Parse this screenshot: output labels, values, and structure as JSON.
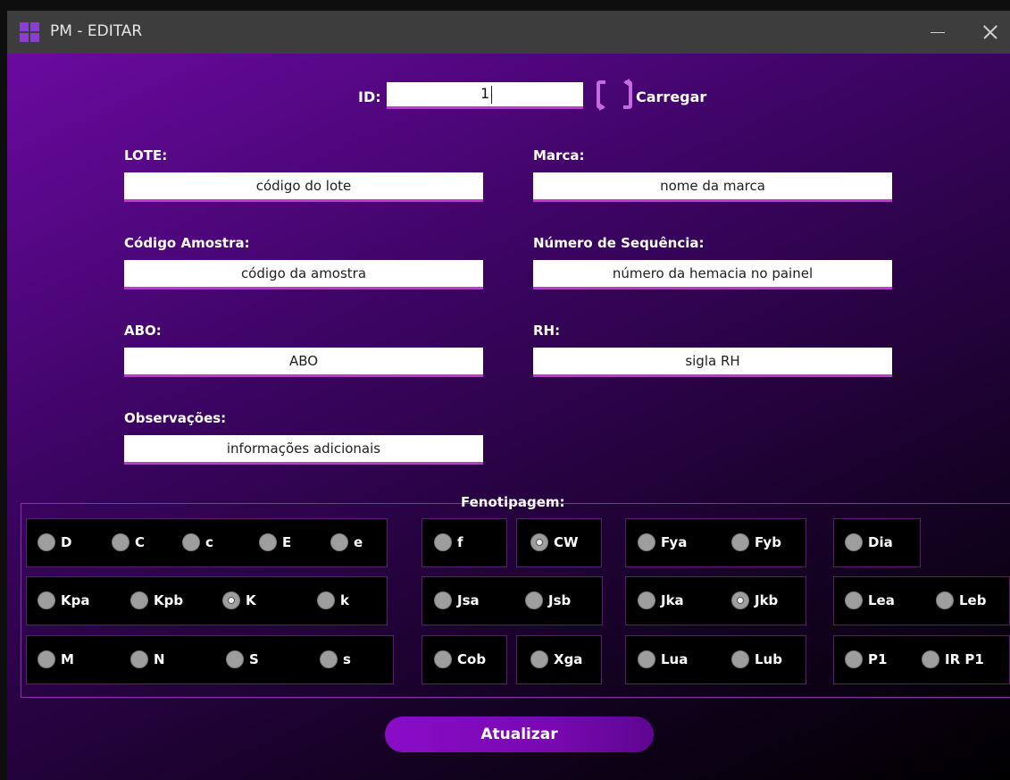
{
  "window": {
    "title": "PM - EDITAR",
    "accent": "#8a3fd0"
  },
  "id_section": {
    "label": "ID:",
    "value": "1",
    "load_label": "Carregar"
  },
  "fields": {
    "lote": {
      "label": "LOTE:",
      "placeholder": "código do lote"
    },
    "marca": {
      "label": "Marca:",
      "placeholder": "nome da marca"
    },
    "codigo_amostra": {
      "label": "Código Amostra:",
      "placeholder": "código da amostra"
    },
    "numero_sequencia": {
      "label": "Número de Sequência:",
      "placeholder": "número da hemacia no painel"
    },
    "abo": {
      "label": "ABO:",
      "placeholder": "ABO"
    },
    "rh": {
      "label": "RH:",
      "placeholder": "sigla RH"
    },
    "observacoes": {
      "label": "Observações:",
      "placeholder": "informações adicionais"
    }
  },
  "fenotipagem": {
    "title": "Fenotipagem:",
    "radios": {
      "D": {
        "label": "D",
        "checked": false
      },
      "C": {
        "label": "C",
        "checked": false
      },
      "c": {
        "label": "c",
        "checked": false
      },
      "E": {
        "label": "E",
        "checked": false
      },
      "e": {
        "label": "e",
        "checked": false
      },
      "f": {
        "label": "f",
        "checked": false
      },
      "CW": {
        "label": "CW",
        "checked": true
      },
      "Fya": {
        "label": "Fya",
        "checked": false
      },
      "Fyb": {
        "label": "Fyb",
        "checked": false
      },
      "Dia": {
        "label": "Dia",
        "checked": false
      },
      "Kpa": {
        "label": "Kpa",
        "checked": false
      },
      "Kpb": {
        "label": "Kpb",
        "checked": false
      },
      "K": {
        "label": "K",
        "checked": true
      },
      "k": {
        "label": "k",
        "checked": false
      },
      "Jsa": {
        "label": "Jsa",
        "checked": false
      },
      "Jsb": {
        "label": "Jsb",
        "checked": false
      },
      "Jka": {
        "label": "Jka",
        "checked": false
      },
      "Jkb": {
        "label": "Jkb",
        "checked": true
      },
      "Lea": {
        "label": "Lea",
        "checked": false
      },
      "Leb": {
        "label": "Leb",
        "checked": false
      },
      "M": {
        "label": "M",
        "checked": false
      },
      "N": {
        "label": "N",
        "checked": false
      },
      "S": {
        "label": "S",
        "checked": false
      },
      "s": {
        "label": "s",
        "checked": false
      },
      "Cob": {
        "label": "Cob",
        "checked": false
      },
      "Xga": {
        "label": "Xga",
        "checked": false
      },
      "Lua": {
        "label": "Lua",
        "checked": false
      },
      "Lub": {
        "label": "Lub",
        "checked": false
      },
      "P1": {
        "label": "P1",
        "checked": false
      },
      "IRP1": {
        "label": "IR P1",
        "checked": false
      }
    }
  },
  "update_button": {
    "label": "Atualizar"
  }
}
